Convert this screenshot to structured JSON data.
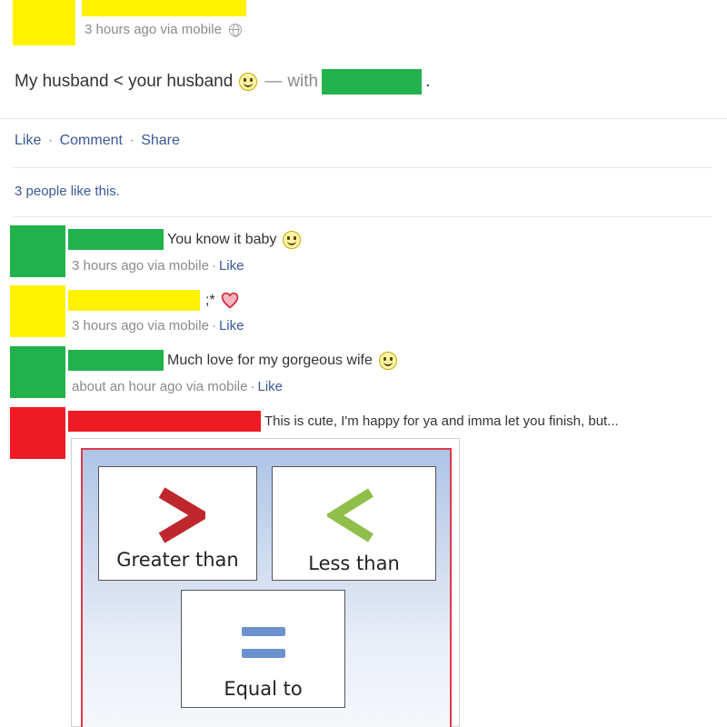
{
  "post": {
    "meta": "3 hours ago via mobile",
    "status_text": "My husband < your husband",
    "with_text": "with",
    "dash": "—",
    "period": ".",
    "actions": {
      "like": "Like",
      "comment": "Comment",
      "share": "Share",
      "sep": "·"
    },
    "likes_text": "3 people like this."
  },
  "comments": [
    {
      "text": "You know it baby",
      "meta": "3 hours ago via mobile",
      "like": "Like"
    },
    {
      "text": ";*",
      "meta": "3 hours ago via mobile",
      "like": "Like"
    },
    {
      "text": "Much love for my gorgeous wife",
      "meta": "about an hour ago via mobile",
      "like": "Like"
    },
    {
      "text": "This is cute, I'm happy for ya and imma let you finish, but..."
    }
  ],
  "image": {
    "greater_symbol": ">",
    "greater_label": "Greater than",
    "less_symbol": "<",
    "less_label": "Less than",
    "equal_label": "Equal to"
  },
  "colors": {
    "redact_yellow": "#fff200",
    "redact_green": "#22b24c",
    "redact_red": "#ed1c24",
    "link_blue": "#3b5998",
    "greater_red": "#c0262d",
    "less_green": "#8fbf4a",
    "equal_blue": "#6b92cf"
  },
  "icons": [
    "globe-icon",
    "smiley-icon",
    "heart-icon"
  ]
}
